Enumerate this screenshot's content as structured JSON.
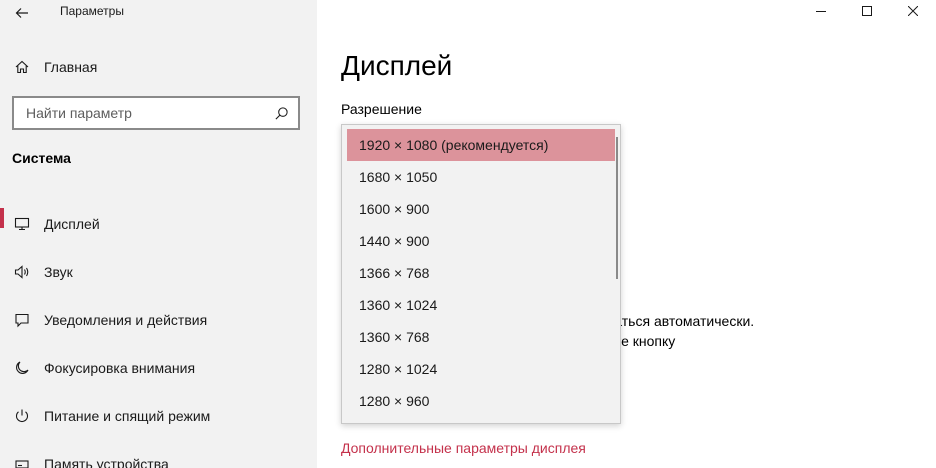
{
  "window": {
    "title": "Параметры"
  },
  "sidebar": {
    "home_label": "Главная",
    "search_placeholder": "Найти параметр",
    "section_title": "Система",
    "items": [
      {
        "label": "Дисплей",
        "icon": "monitor-icon",
        "active": true
      },
      {
        "label": "Звук",
        "icon": "speaker-icon",
        "active": false
      },
      {
        "label": "Уведомления и действия",
        "icon": "notification-icon",
        "active": false
      },
      {
        "label": "Фокусировка внимания",
        "icon": "moon-icon",
        "active": false
      },
      {
        "label": "Питание и спящий режим",
        "icon": "power-icon",
        "active": false
      },
      {
        "label": "Память устройства",
        "icon": "storage-icon",
        "active": false
      }
    ]
  },
  "main": {
    "page_title": "Дисплей",
    "resolution_label": "Разрешение",
    "resolution_options": [
      "1920 × 1080 (рекомендуется)",
      "1680 × 1050",
      "1600 × 900",
      "1440 × 900",
      "1366 × 768",
      "1360 × 1024",
      "1360 × 768",
      "1280 × 1024",
      "1280 × 960"
    ],
    "selected_option": "1920 × 1080 (рекомендуется)",
    "bg_text_line1": "чаться автоматически.",
    "bg_text_line2": "ите кнопку",
    "advanced_link": "Дополнительные параметры дисплея"
  },
  "colors": {
    "accent": "#c4314b",
    "selected_bg": "#dc939b",
    "sidebar_bg": "#f2f2f2"
  }
}
